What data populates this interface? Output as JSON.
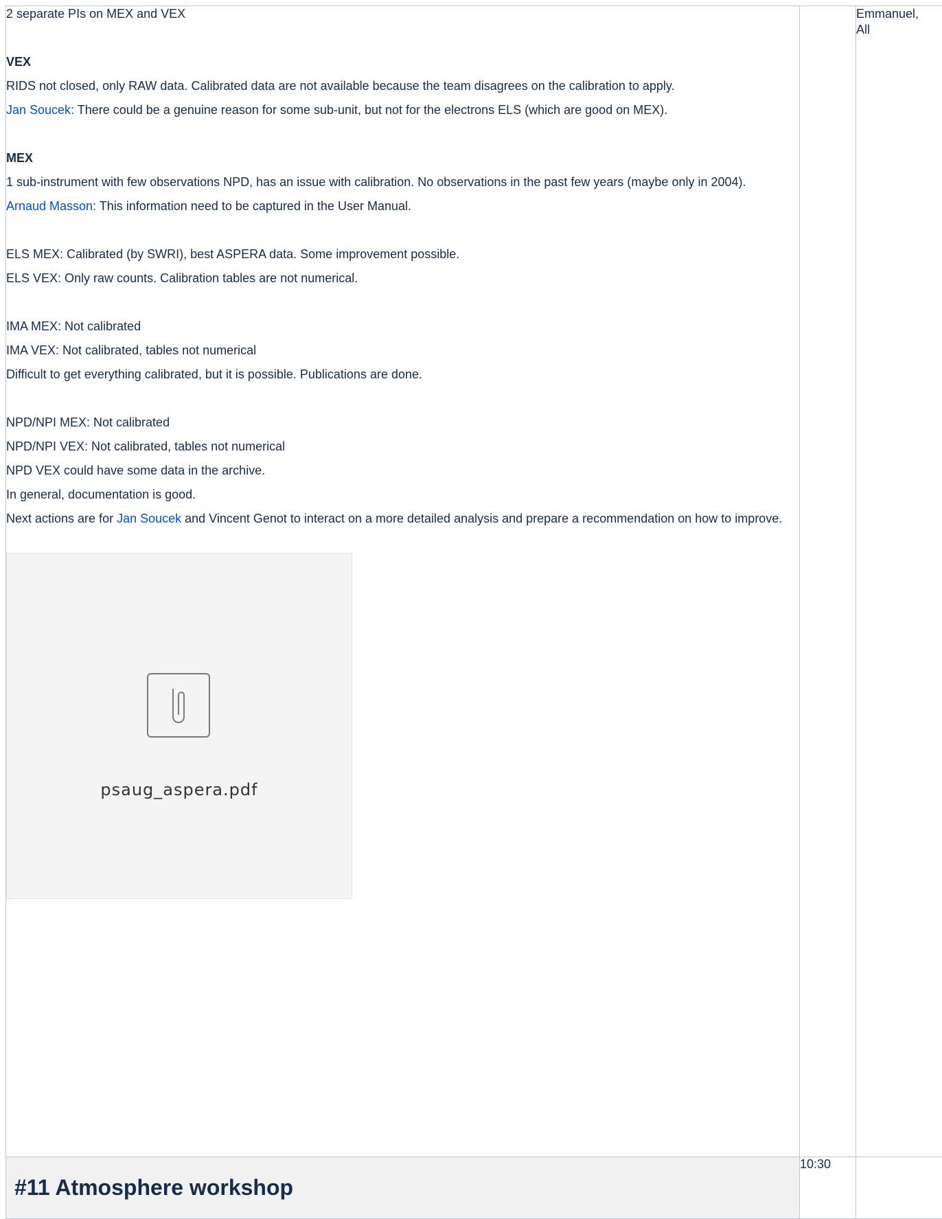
{
  "row1": {
    "intro": "2 separate PIs on MEX and VEX",
    "vex_heading": "VEX",
    "vex_p1": "RIDS not closed, only RAW data. Calibrated data are not available because the team disagrees on the calibration to apply.",
    "vex_p2_user": "Jan Soucek",
    "vex_p2_text": ": There could be a genuine reason for some sub-unit, but not for the electrons ELS (which are good on MEX).",
    "mex_heading": "MEX",
    "mex_p1": "1 sub-instrument with few observations NPD, has an issue with calibration. No observations in the past few years (maybe only in 2004).",
    "mex_p2_user": "Arnaud Masson",
    "mex_p2_text": ": This information need to be captured in the User Manual.",
    "els_mex": "ELS MEX: Calibrated (by SWRI), best ASPERA data. Some improvement possible.",
    "els_vex": "ELS VEX: Only raw counts. Calibration tables are not numerical.",
    "ima_mex": "IMA MEX: Not calibrated",
    "ima_vex": "IMA VEX: Not calibrated, tables not numerical",
    "difficult": "Difficult to get everything calibrated, but it is possible. Publications are done.",
    "npd_mex": "NPD/NPI MEX: Not calibrated",
    "npd_vex": "NPD/NPI VEX: Not calibrated, tables not numerical",
    "npd_archive": "NPD VEX could have some data in the archive.",
    "general": "In general, documentation is good.",
    "next_prefix": "Next actions are for ",
    "next_user": "Jan Soucek",
    "next_suffix": " and Vincent Genot to interact on a more detailed analysis and prepare a recommendation on how to improve.",
    "attachment_filename": "psaug_aspera.pdf",
    "attachment_icon": "paperclip-icon",
    "time": "",
    "who_line1": "Emmanuel,",
    "who_line2": "All"
  },
  "row2": {
    "title": "#11 Atmosphere workshop",
    "time": "10:30",
    "who": ""
  },
  "colors": {
    "link": "#0052cc",
    "text": "#172b4d",
    "border": "#c1c7d0",
    "heading_bg": "#f1f1f1"
  }
}
